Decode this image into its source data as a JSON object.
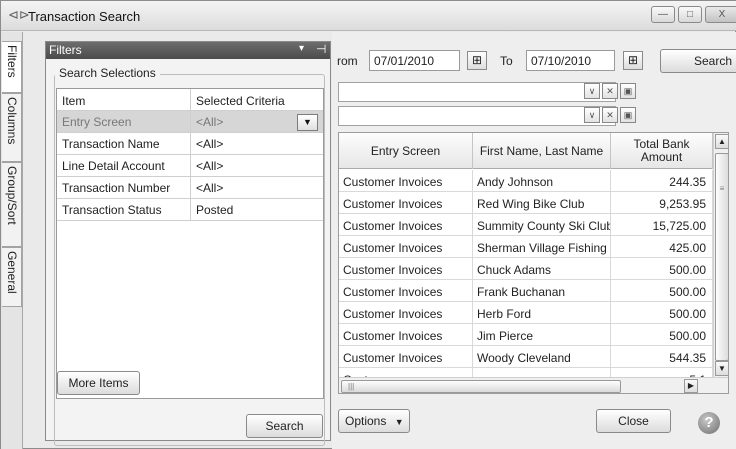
{
  "window": {
    "title": "Transaction Search",
    "minimize_glyph": "—",
    "maximize_glyph": "□",
    "close_glyph": "X"
  },
  "side_tabs": [
    "Filters",
    "Columns",
    "Group/Sort",
    "General"
  ],
  "filters_panel": {
    "title": "Filters",
    "dropdown_glyph": "▾",
    "pin_glyph": "⊣",
    "section_label": "Search Selections",
    "columns": [
      "Item",
      "Selected Criteria"
    ],
    "rows": [
      {
        "item": "Entry Screen",
        "criteria": "<All>"
      },
      {
        "item": "Transaction Name",
        "criteria": "<All>"
      },
      {
        "item": "Line Detail Account",
        "criteria": "<All>"
      },
      {
        "item": "Transaction Number",
        "criteria": "<All>"
      },
      {
        "item": "Transaction Status",
        "criteria": "Posted"
      }
    ],
    "more_items_label": "More Items",
    "search_label": "Search"
  },
  "date_range": {
    "from_label": "rom",
    "from_value": "07/01/2010",
    "to_label": "To",
    "to_value": "07/10/2010"
  },
  "search_label": "Search",
  "results": {
    "columns": [
      "Entry Screen",
      "First Name, Last Name",
      "Total Bank Amount"
    ],
    "rows": [
      {
        "entry": "Customer Invoices",
        "name": "Andy Johnson",
        "amount": "244.35"
      },
      {
        "entry": "Customer Invoices",
        "name": "Red Wing Bike Club",
        "amount": "9,253.95"
      },
      {
        "entry": "Customer Invoices",
        "name": "Summity County Ski Club",
        "amount": "15,725.00"
      },
      {
        "entry": "Customer Invoices",
        "name": "Sherman Village Fishing (",
        "amount": "425.00"
      },
      {
        "entry": "Customer Invoices",
        "name": "Chuck Adams",
        "amount": "500.00"
      },
      {
        "entry": "Customer Invoices",
        "name": "Frank Buchanan",
        "amount": "500.00"
      },
      {
        "entry": "Customer Invoices",
        "name": "Herb Ford",
        "amount": "500.00"
      },
      {
        "entry": "Customer Invoices",
        "name": "Jim Pierce",
        "amount": "500.00"
      },
      {
        "entry": "Customer Invoices",
        "name": "Woody Cleveland",
        "amount": "544.35"
      },
      {
        "entry": "Cust",
        "name": "",
        "amount": "5,1"
      }
    ]
  },
  "options_label": "Options",
  "close_label": "Close",
  "help_glyph": "?"
}
